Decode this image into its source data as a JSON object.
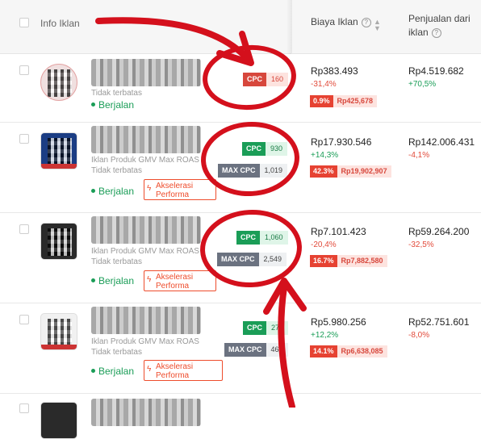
{
  "header": {
    "col_info": "Info Iklan",
    "col_biaya": "Biaya Iklan",
    "col_penjualan_line1": "Penjualan dari",
    "col_penjualan_line2": "iklan",
    "help_icon": "question-circle-icon",
    "sort_icon": "sort-icon"
  },
  "rows": [
    {
      "sub1": "",
      "sub2": "Tidak terbatas",
      "status": "Berjalan",
      "cpc_label": "CPC",
      "cpc_value": "160",
      "biaya": "Rp383.493",
      "biaya_change": "-31,4%",
      "roas_pct": "0.9%",
      "roas_amount": "Rp425,678",
      "penjualan": "Rp4.519.682",
      "penjualan_change": "+70,5%"
    },
    {
      "sub1": "Iklan Produk GMV Max ROAS",
      "sub2": "Tidak terbatas",
      "status": "Berjalan",
      "accel_line1": "Akselerasi",
      "accel_line2": "Performa",
      "cpc_label": "CPC",
      "cpc_value": "930",
      "max_label": "MAX CPC",
      "max_value": "1,019",
      "biaya": "Rp17.930.546",
      "biaya_change": "+14,3%",
      "roas_pct": "42.3%",
      "roas_amount": "Rp19,902,907",
      "penjualan": "Rp142.006.431",
      "penjualan_change": "-4,1%"
    },
    {
      "sub1": "Iklan Produk GMV Max ROAS",
      "sub2": "Tidak terbatas",
      "status": "Berjalan",
      "accel_line1": "Akselerasi",
      "accel_line2": "Performa",
      "cpc_label": "CPC",
      "cpc_value": "1,060",
      "max_label": "MAX CPC",
      "max_value": "2,549",
      "biaya": "Rp7.101.423",
      "biaya_change": "-20,4%",
      "roas_pct": "16.7%",
      "roas_amount": "Rp7,882,580",
      "penjualan": "Rp59.264.200",
      "penjualan_change": "-32,5%"
    },
    {
      "sub1": "Iklan Produk GMV Max ROAS",
      "sub2": "Tidak terbatas",
      "status": "Berjalan",
      "accel_line1": "Akselerasi",
      "accel_line2": "Performa",
      "cpc_label": "CPC",
      "cpc_value": "277",
      "max_label": "MAX CPC",
      "max_value": "466",
      "biaya": "Rp5.980.256",
      "biaya_change": "+12,2%",
      "roas_pct": "14.1%",
      "roas_amount": "Rp6,638,085",
      "penjualan": "Rp52.751.601",
      "penjualan_change": "-8,0%"
    }
  ],
  "colors": {
    "annotation_red": "#d4101c",
    "status_green": "#1a9d57",
    "negative_red": "#e24b3b",
    "accent_orange": "#ee4d2d"
  }
}
